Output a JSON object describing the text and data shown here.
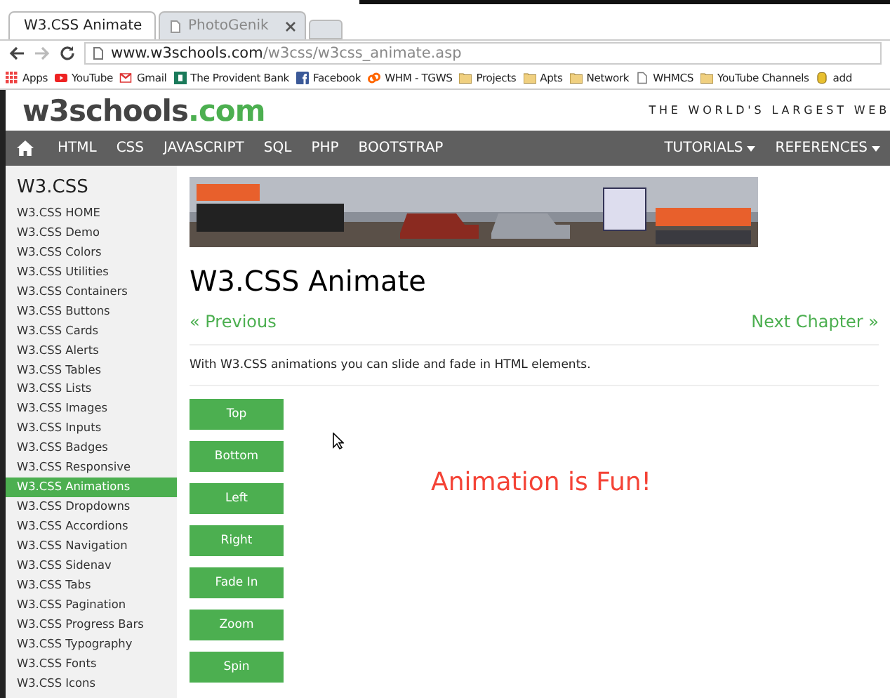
{
  "browser": {
    "tabs": [
      {
        "label": "W3.CSS Animate",
        "selected": true
      },
      {
        "label": "PhotoGenik",
        "selected": false
      }
    ],
    "address": {
      "host": "www.w3schools.com",
      "path": "/w3css/w3css_animate.asp"
    },
    "bookmarks": [
      {
        "label": "Apps",
        "kind": "apps"
      },
      {
        "label": "YouTube",
        "kind": "youtube"
      },
      {
        "label": "Gmail",
        "kind": "gmail"
      },
      {
        "label": "The Provident Bank",
        "kind": "bank"
      },
      {
        "label": "Facebook",
        "kind": "facebook"
      },
      {
        "label": "WHM - TGWS",
        "kind": "whm"
      },
      {
        "label": "Projects",
        "kind": "folder"
      },
      {
        "label": "Apts",
        "kind": "folder"
      },
      {
        "label": "Network",
        "kind": "folder"
      },
      {
        "label": "WHMCS",
        "kind": "page"
      },
      {
        "label": "YouTube Channels",
        "kind": "folder"
      },
      {
        "label": "add",
        "kind": "db"
      }
    ]
  },
  "site": {
    "logo": {
      "main": "w3schools",
      "accent": ".com"
    },
    "tagline": "THE WORLD'S LARGEST WEB",
    "nav": [
      {
        "label": "HTML",
        "dropdown": false
      },
      {
        "label": "CSS",
        "dropdown": false
      },
      {
        "label": "JAVASCRIPT",
        "dropdown": false
      },
      {
        "label": "SQL",
        "dropdown": false
      },
      {
        "label": "PHP",
        "dropdown": false
      },
      {
        "label": "BOOTSTRAP",
        "dropdown": false
      }
    ],
    "nav_right": [
      {
        "label": "TUTORIALS",
        "dropdown": true
      },
      {
        "label": "REFERENCES",
        "dropdown": true
      }
    ]
  },
  "sidebar": {
    "title": "W3.CSS",
    "items": [
      {
        "label": "W3.CSS HOME",
        "selected": false
      },
      {
        "label": "W3.CSS Demo",
        "selected": false
      },
      {
        "label": "W3.CSS Colors",
        "selected": false
      },
      {
        "label": "W3.CSS Utilities",
        "selected": false
      },
      {
        "label": "W3.CSS Containers",
        "selected": false
      },
      {
        "label": "W3.CSS Buttons",
        "selected": false
      },
      {
        "label": "W3.CSS Cards",
        "selected": false
      },
      {
        "label": "W3.CSS Alerts",
        "selected": false
      },
      {
        "label": "W3.CSS Tables",
        "selected": false
      },
      {
        "label": "W3.CSS Lists",
        "selected": false
      },
      {
        "label": "W3.CSS Images",
        "selected": false
      },
      {
        "label": "W3.CSS Inputs",
        "selected": false
      },
      {
        "label": "W3.CSS Badges",
        "selected": false
      },
      {
        "label": "W3.CSS Responsive",
        "selected": false
      },
      {
        "label": "W3.CSS Animations",
        "selected": true
      },
      {
        "label": "W3.CSS Dropdowns",
        "selected": false
      },
      {
        "label": "W3.CSS Accordions",
        "selected": false
      },
      {
        "label": "W3.CSS Navigation",
        "selected": false
      },
      {
        "label": "W3.CSS Sidenav",
        "selected": false
      },
      {
        "label": "W3.CSS Tabs",
        "selected": false
      },
      {
        "label": "W3.CSS Pagination",
        "selected": false
      },
      {
        "label": "W3.CSS Progress Bars",
        "selected": false
      },
      {
        "label": "W3.CSS Typography",
        "selected": false
      },
      {
        "label": "W3.CSS Fonts",
        "selected": false
      },
      {
        "label": "W3.CSS Icons",
        "selected": false
      }
    ]
  },
  "main": {
    "title": "W3.CSS Animate",
    "previous": "« Previous",
    "next": "Next Chapter »",
    "intro": "With W3.CSS animations you can slide and fade in HTML elements.",
    "buttons": [
      "Top",
      "Bottom",
      "Left",
      "Right",
      "Fade In",
      "Zoom",
      "Spin"
    ],
    "demo_text": "Animation is Fun!"
  }
}
